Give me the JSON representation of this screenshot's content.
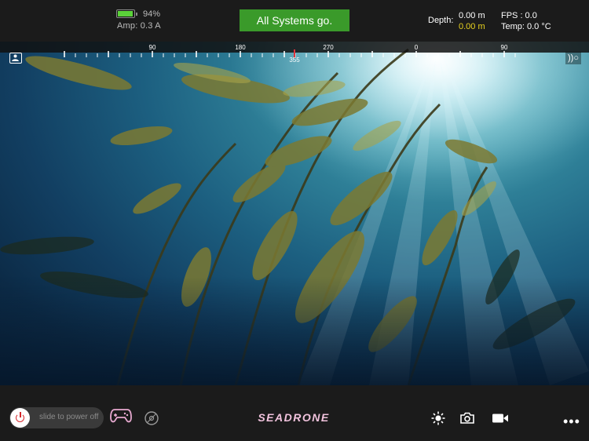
{
  "header": {
    "battery_percent": "94%",
    "battery_level": 0.94,
    "amp": "Amp: 0.3 A",
    "status": "All Systems go.",
    "depth_label": "Depth:",
    "depth_value": "0.00 m",
    "depth_target": "0.00 m",
    "fps": "FPS : 0.0",
    "temp": "Temp: 0.0 °C"
  },
  "compass": {
    "labels": [
      "90",
      "180",
      "270",
      "0",
      "90"
    ],
    "heading": "355"
  },
  "footer": {
    "slider_label": "slide to power off",
    "brand": "SEADRONE"
  },
  "icons": {
    "battery": "battery-icon",
    "camera_toggle": "camera-toggle-icon",
    "sonar": "sonar-icon",
    "gamepad": "gamepad-icon",
    "disc": "disc-icon",
    "brightness": "sun-icon",
    "photo": "camera-icon",
    "video": "video-icon",
    "more": "more-icon"
  },
  "colors": {
    "status_green": "#3a9a2a",
    "battery_green": "#5bd23a",
    "depth_target_yellow": "#e8d21f",
    "heading_marker": "#e0303a",
    "brand_pink": "#f1c3dd",
    "bar_background": "#1b1b1b"
  }
}
